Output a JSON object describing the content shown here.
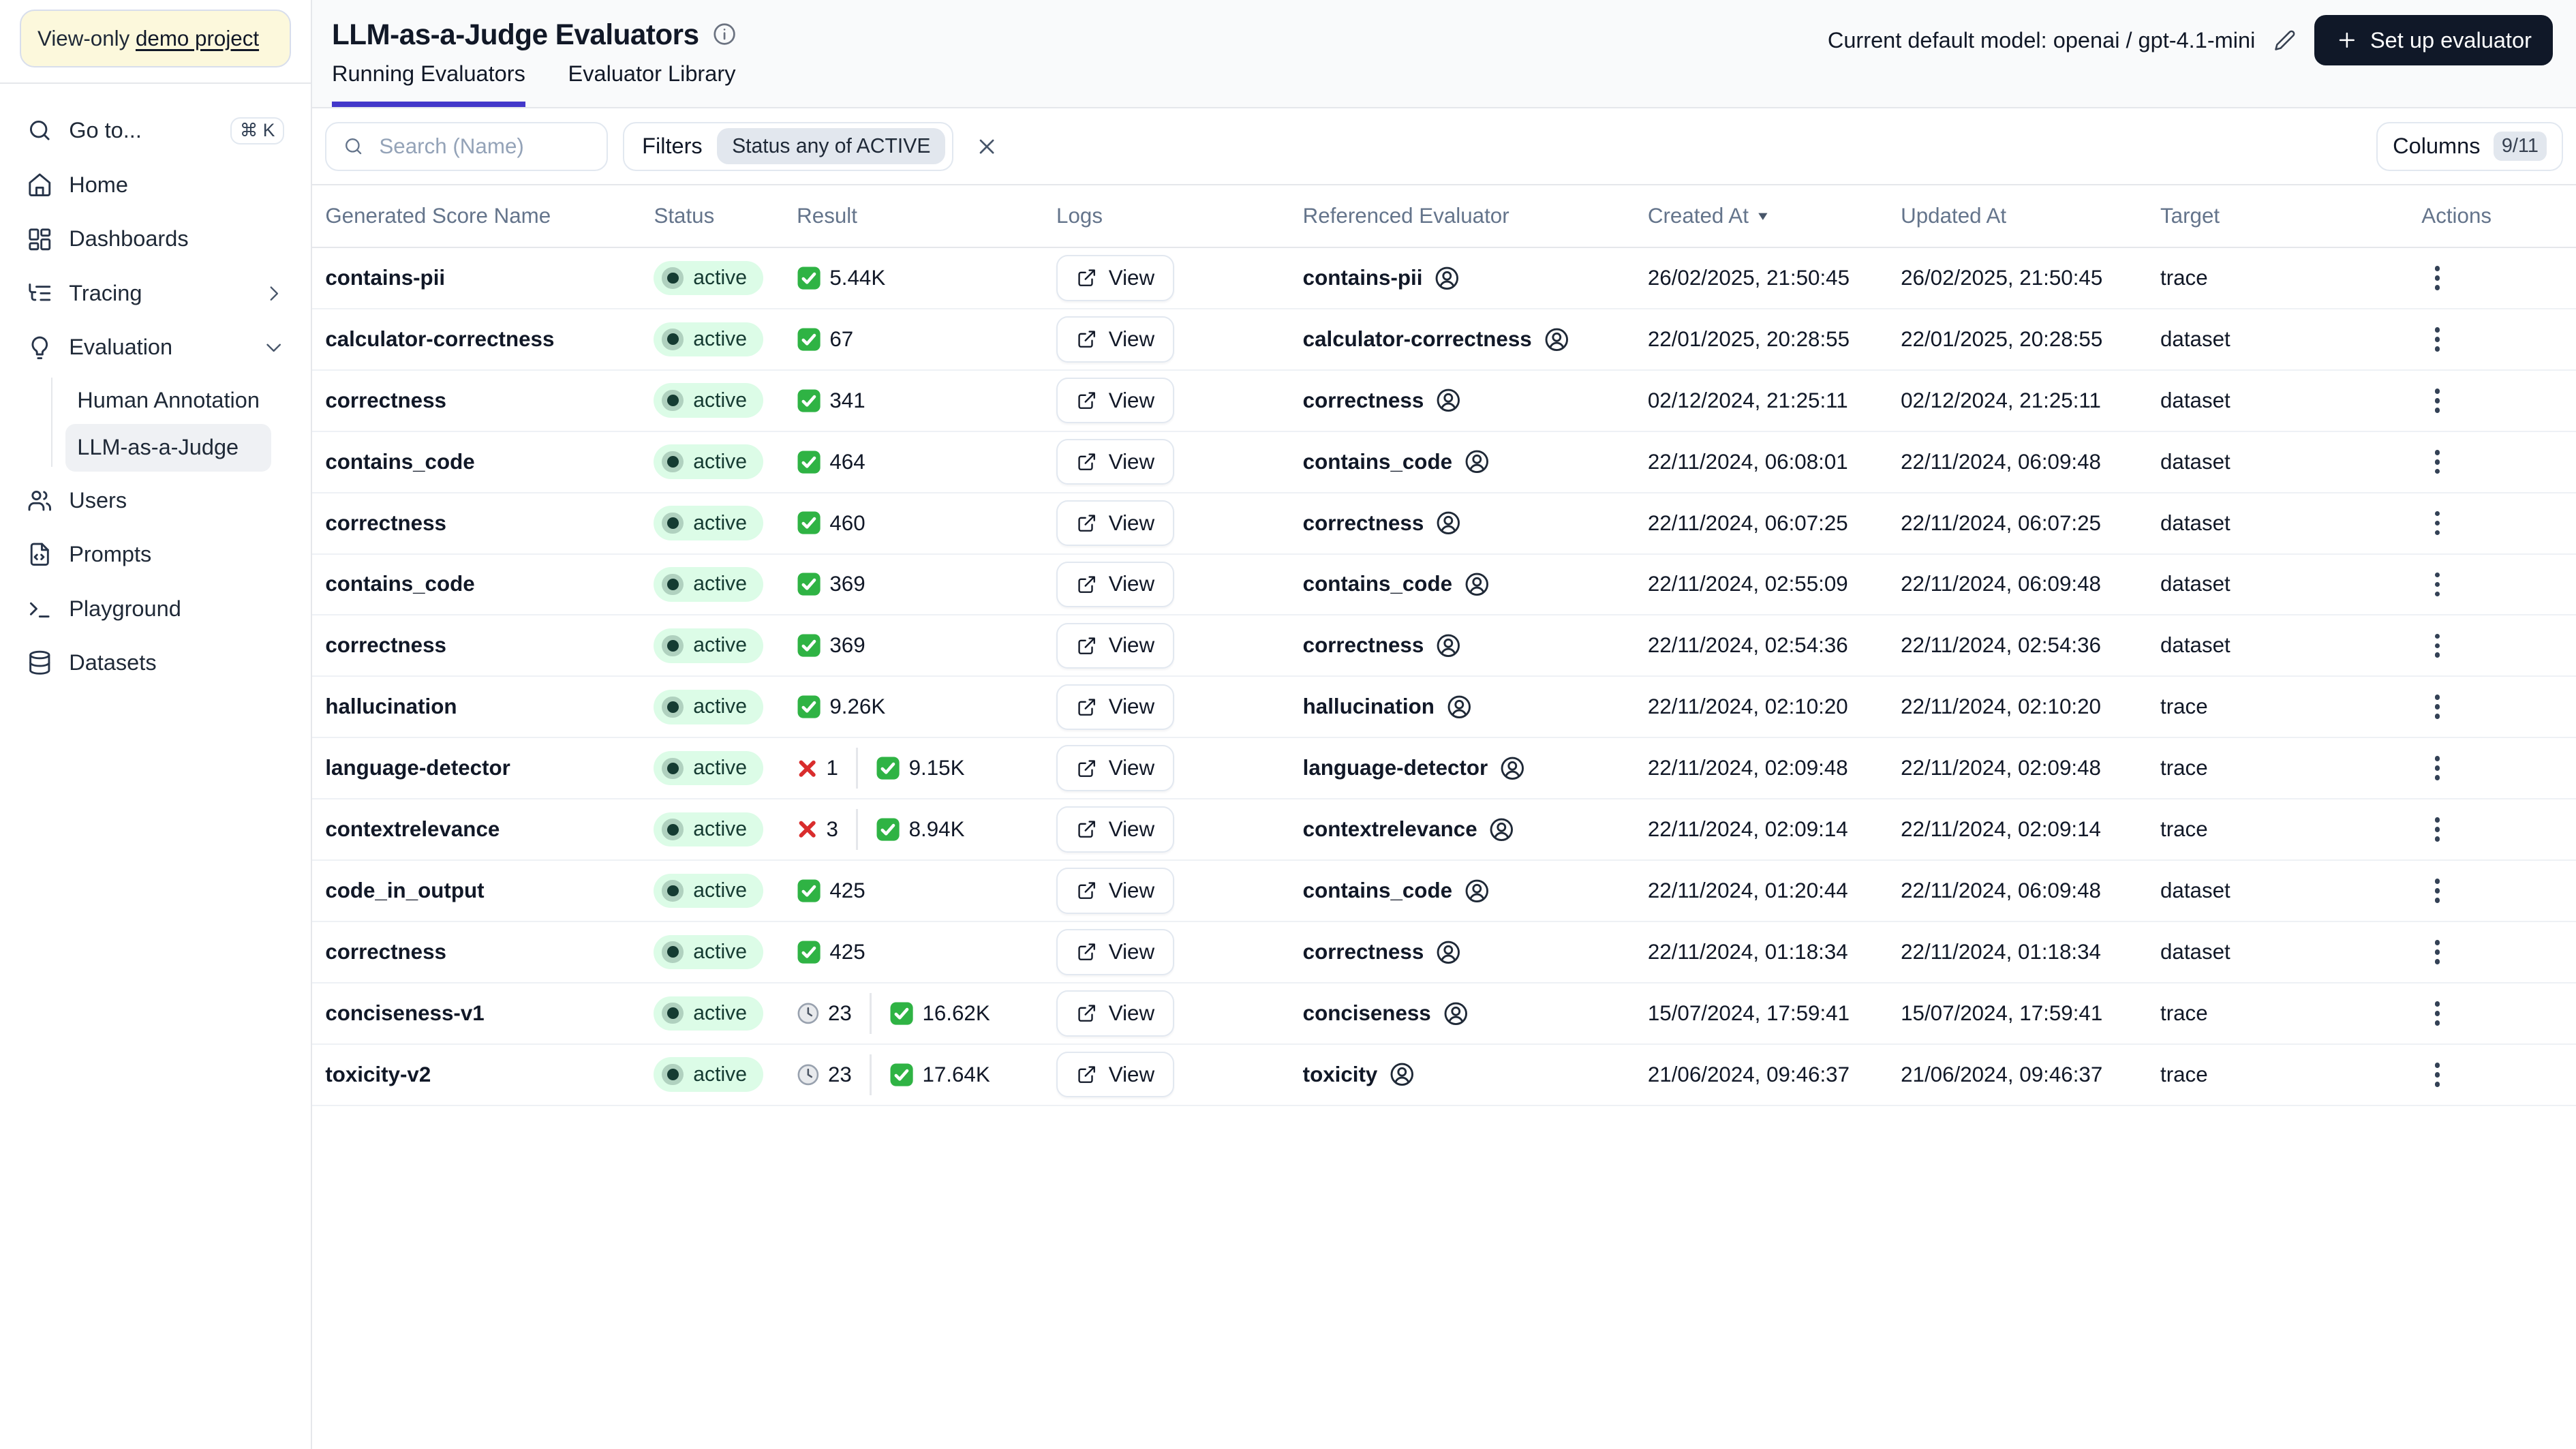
{
  "colors": {
    "accent_indigo": "#4338CA",
    "pass_green": "#2FB344",
    "fail_red": "#D92D2D",
    "status_pill_bg": "#DCFCE7",
    "status_pill_text": "#153B32",
    "primary_button_bg": "#101828",
    "banner_bg": "#FCF8DC"
  },
  "sidebar": {
    "banner": {
      "prefix": "View-only ",
      "link": "demo project"
    },
    "items": [
      {
        "label": "Go to...",
        "icon": "search-icon",
        "shortcut": "⌘ K"
      },
      {
        "label": "Home",
        "icon": "home-icon"
      },
      {
        "label": "Dashboards",
        "icon": "dashboards-icon"
      },
      {
        "label": "Tracing",
        "icon": "tracing-icon",
        "chevron": "right"
      },
      {
        "label": "Evaluation",
        "icon": "evaluation-icon",
        "chevron": "down"
      },
      {
        "label": "Users",
        "icon": "users-icon"
      },
      {
        "label": "Prompts",
        "icon": "prompts-icon"
      },
      {
        "label": "Playground",
        "icon": "playground-icon"
      },
      {
        "label": "Datasets",
        "icon": "datasets-icon"
      }
    ],
    "sub_items": [
      {
        "label": "Human Annotation",
        "active": false
      },
      {
        "label": "LLM-as-a-Judge",
        "active": true
      }
    ]
  },
  "header": {
    "title": "LLM-as-a-Judge Evaluators",
    "model_label": "Current default model: openai / gpt-4.1-mini",
    "setup_button": "Set up evaluator"
  },
  "tabs": [
    {
      "label": "Running Evaluators",
      "active": true
    },
    {
      "label": "Evaluator Library",
      "active": false
    }
  ],
  "toolbar": {
    "search_placeholder": "Search (Name)",
    "filters_label": "Filters",
    "filter_chip": "Status any of ACTIVE",
    "columns_label": "Columns",
    "columns_badge": "9/11"
  },
  "table": {
    "view_label": "View",
    "columns": [
      "Generated Score Name",
      "Status",
      "Result",
      "Logs",
      "Referenced Evaluator",
      "Created At",
      "Updated At",
      "Target",
      "Actions"
    ],
    "sorted_column": "Created At",
    "sort_direction": "desc",
    "rows": [
      {
        "name": "contains-pii",
        "status": "active",
        "fail": null,
        "pending": null,
        "pass": "5.44K",
        "evaluator": "contains-pii",
        "created": "26/02/2025, 21:50:45",
        "updated": "26/02/2025, 21:50:45",
        "target": "trace"
      },
      {
        "name": "calculator-correctness",
        "status": "active",
        "fail": null,
        "pending": null,
        "pass": "67",
        "evaluator": "calculator-correctness",
        "created": "22/01/2025, 20:28:55",
        "updated": "22/01/2025, 20:28:55",
        "target": "dataset"
      },
      {
        "name": "correctness",
        "status": "active",
        "fail": null,
        "pending": null,
        "pass": "341",
        "evaluator": "correctness",
        "created": "02/12/2024, 21:25:11",
        "updated": "02/12/2024, 21:25:11",
        "target": "dataset"
      },
      {
        "name": "contains_code",
        "status": "active",
        "fail": null,
        "pending": null,
        "pass": "464",
        "evaluator": "contains_code",
        "created": "22/11/2024, 06:08:01",
        "updated": "22/11/2024, 06:09:48",
        "target": "dataset"
      },
      {
        "name": "correctness",
        "status": "active",
        "fail": null,
        "pending": null,
        "pass": "460",
        "evaluator": "correctness",
        "created": "22/11/2024, 06:07:25",
        "updated": "22/11/2024, 06:07:25",
        "target": "dataset"
      },
      {
        "name": "contains_code",
        "status": "active",
        "fail": null,
        "pending": null,
        "pass": "369",
        "evaluator": "contains_code",
        "created": "22/11/2024, 02:55:09",
        "updated": "22/11/2024, 06:09:48",
        "target": "dataset"
      },
      {
        "name": "correctness",
        "status": "active",
        "fail": null,
        "pending": null,
        "pass": "369",
        "evaluator": "correctness",
        "created": "22/11/2024, 02:54:36",
        "updated": "22/11/2024, 02:54:36",
        "target": "dataset"
      },
      {
        "name": "hallucination",
        "status": "active",
        "fail": null,
        "pending": null,
        "pass": "9.26K",
        "evaluator": "hallucination",
        "created": "22/11/2024, 02:10:20",
        "updated": "22/11/2024, 02:10:20",
        "target": "trace"
      },
      {
        "name": "language-detector",
        "status": "active",
        "fail": "1",
        "pending": null,
        "pass": "9.15K",
        "evaluator": "language-detector",
        "created": "22/11/2024, 02:09:48",
        "updated": "22/11/2024, 02:09:48",
        "target": "trace"
      },
      {
        "name": "contextrelevance",
        "status": "active",
        "fail": "3",
        "pending": null,
        "pass": "8.94K",
        "evaluator": "contextrelevance",
        "created": "22/11/2024, 02:09:14",
        "updated": "22/11/2024, 02:09:14",
        "target": "trace"
      },
      {
        "name": "code_in_output",
        "status": "active",
        "fail": null,
        "pending": null,
        "pass": "425",
        "evaluator": "contains_code",
        "created": "22/11/2024, 01:20:44",
        "updated": "22/11/2024, 06:09:48",
        "target": "dataset"
      },
      {
        "name": "correctness",
        "status": "active",
        "fail": null,
        "pending": null,
        "pass": "425",
        "evaluator": "correctness",
        "created": "22/11/2024, 01:18:34",
        "updated": "22/11/2024, 01:18:34",
        "target": "dataset"
      },
      {
        "name": "conciseness-v1",
        "status": "active",
        "fail": null,
        "pending": "23",
        "pass": "16.62K",
        "evaluator": "conciseness",
        "created": "15/07/2024, 17:59:41",
        "updated": "15/07/2024, 17:59:41",
        "target": "trace"
      },
      {
        "name": "toxicity-v2",
        "status": "active",
        "fail": null,
        "pending": "23",
        "pass": "17.64K",
        "evaluator": "toxicity",
        "created": "21/06/2024, 09:46:37",
        "updated": "21/06/2024, 09:46:37",
        "target": "trace"
      }
    ]
  }
}
